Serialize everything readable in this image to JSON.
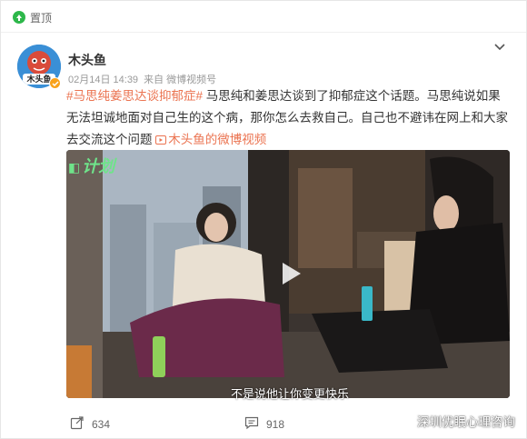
{
  "pin": {
    "label": "置顶",
    "icon": "pin-icon"
  },
  "post": {
    "author": "木头鱼",
    "avatar_text": "木头鱼",
    "date": "02月14日 14:39",
    "source": "来自 微博视频号",
    "hashtag": "#马思纯姜思达谈抑郁症#",
    "body": " 马思纯和姜思达谈到了抑郁症这个话题。马思纯说如果无法坦诚地面对自己生的这个病，那你怎么去救自己。自己也不避讳在网上和大家去交流这个问题 ",
    "video_link": "木头鱼的微博视频"
  },
  "video": {
    "show_logo": "计划",
    "subtitle": "不是说他让你变更快乐"
  },
  "actions": {
    "share_count": "634",
    "comment_count": "918"
  },
  "watermark": {
    "text": "深圳优眠心理咨询"
  },
  "colors": {
    "accent": "#eb7350",
    "green_pin": "#2db74a"
  }
}
